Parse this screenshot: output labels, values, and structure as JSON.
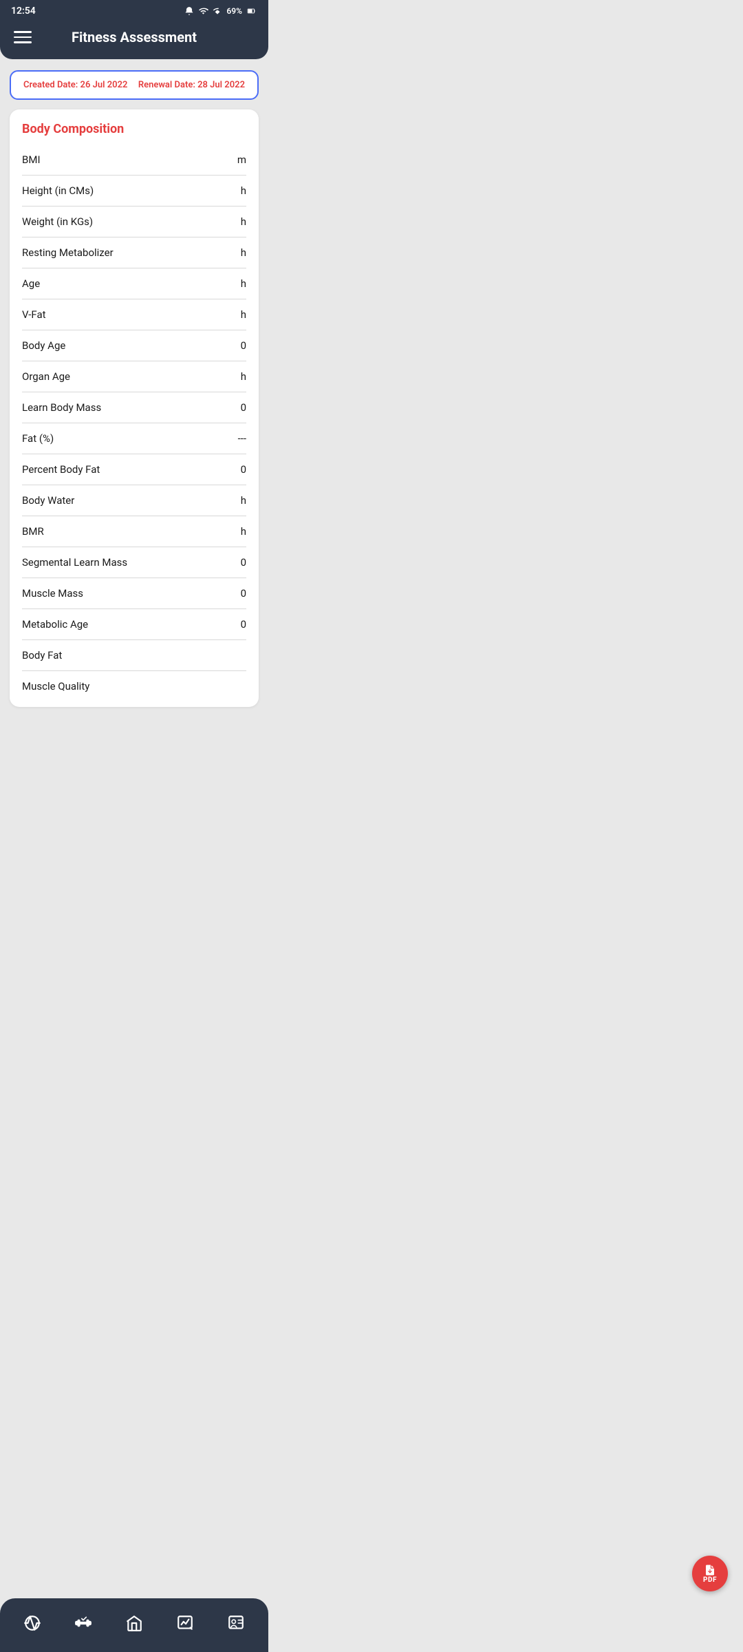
{
  "statusBar": {
    "time": "12:54",
    "battery": "69%"
  },
  "header": {
    "title": "Fitness Assessment",
    "menuIcon": "hamburger-menu-icon"
  },
  "dateCard": {
    "createdLabel": "Created Date: 26 Jul 2022",
    "renewalLabel": "Renewal Date: 28 Jul 2022"
  },
  "bodyComposition": {
    "sectionTitle": "Body Composition",
    "metrics": [
      {
        "label": "BMI",
        "value": "m"
      },
      {
        "label": "Height (in CMs)",
        "value": "h"
      },
      {
        "label": "Weight (in KGs)",
        "value": "h"
      },
      {
        "label": "Resting Metabolizer",
        "value": "h"
      },
      {
        "label": "Age",
        "value": "h"
      },
      {
        "label": "V-Fat",
        "value": "h"
      },
      {
        "label": "Body Age",
        "value": "0"
      },
      {
        "label": "Organ Age",
        "value": "h"
      },
      {
        "label": "Learn Body Mass",
        "value": "0"
      },
      {
        "label": "Fat (%)",
        "value": "---"
      },
      {
        "label": "Percent Body Fat",
        "value": "0"
      },
      {
        "label": "Body Water",
        "value": "h"
      },
      {
        "label": "BMR",
        "value": "h"
      },
      {
        "label": "Segmental Learn Mass",
        "value": "0"
      },
      {
        "label": "Muscle Mass",
        "value": "0"
      },
      {
        "label": "Metabolic Age",
        "value": "0"
      },
      {
        "label": "Body Fat",
        "value": ""
      },
      {
        "label": "Muscle Quality",
        "value": ""
      }
    ]
  },
  "pdfButton": {
    "label": "PDF",
    "icon": "pdf-export-icon"
  },
  "bottomNav": {
    "items": [
      {
        "name": "heart-rate-icon",
        "label": "Heart Rate"
      },
      {
        "name": "fitness-icon",
        "label": "Fitness"
      },
      {
        "name": "home-icon",
        "label": "Home"
      },
      {
        "name": "progress-icon",
        "label": "Progress"
      },
      {
        "name": "profile-icon",
        "label": "Profile"
      }
    ]
  }
}
